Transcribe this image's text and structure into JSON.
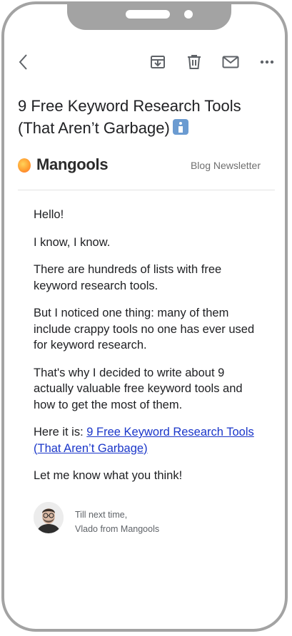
{
  "toolbar": {
    "back_icon": "arrow-left-icon",
    "archive_icon": "archive-icon",
    "delete_icon": "trash-icon",
    "mark_unread_icon": "mail-icon",
    "more_icon": "more-horizontal-icon"
  },
  "email": {
    "subject": "9 Free Keyword Research Tools (That Aren’t Garbage)",
    "sender_brand": "Mangools",
    "label": "Blog Newsletter",
    "paragraphs": {
      "p1": "Hello!",
      "p2": "I know, I know.",
      "p3": "There are hundreds of lists with free keyword research tools.",
      "p4": "But I noticed one thing: many of them include crappy tools no one has ever used for keyword research.",
      "p5": "That's why I decided to write about 9 actually valuable free keyword tools and how to get the most of them.",
      "p6_prefix": "Here it is: ",
      "p6_link": "9 Free Keyword Research Tools (That Aren’t Garbage)",
      "p7": "Let me know what you think!"
    },
    "signature": {
      "line1": "Till next time,",
      "line2": "Vlado from Mangools"
    }
  },
  "colors": {
    "link": "#1a36c9",
    "frame": "#a3a3a3"
  }
}
